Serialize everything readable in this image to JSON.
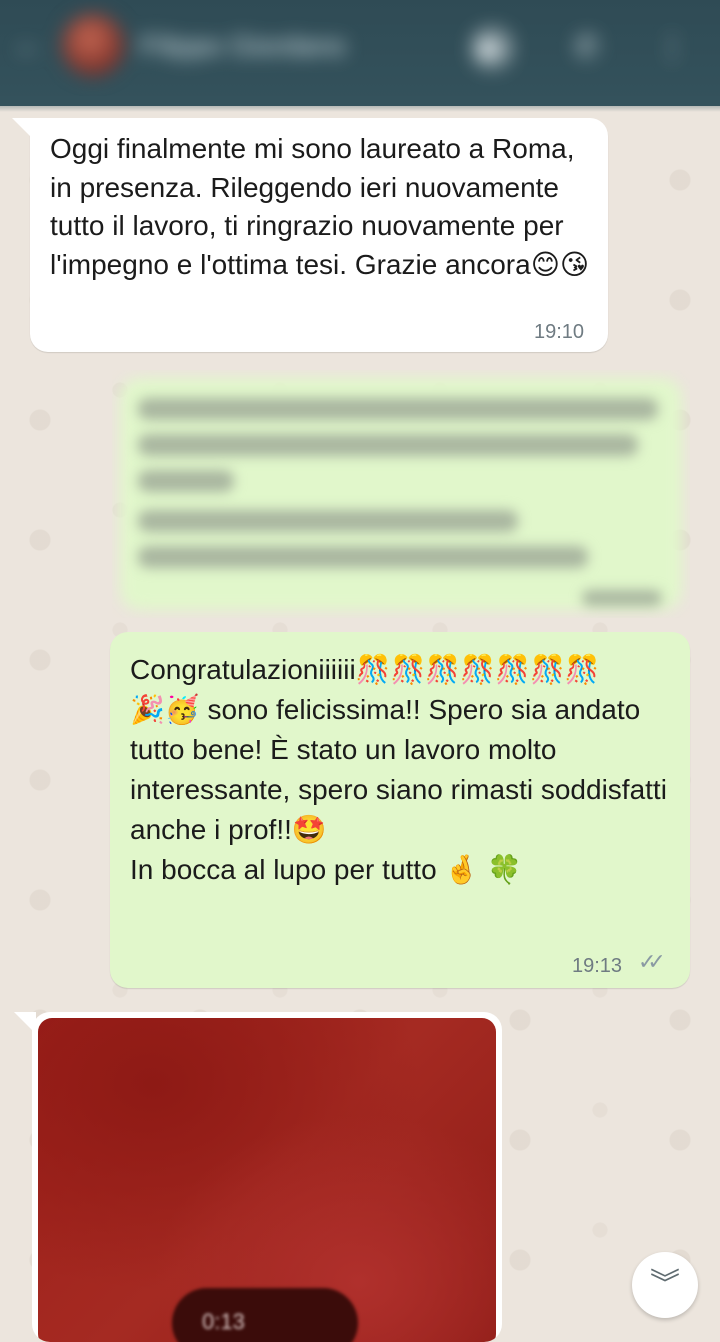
{
  "header": {
    "back_icon": "arrow-left-icon",
    "contact_name": "Filippo Giordano",
    "video_icon": "video-camera-icon",
    "call_icon": "phone-icon",
    "menu_icon": "vertical-dots-icon"
  },
  "messages": [
    {
      "direction": "incoming",
      "text": "Oggi finalmente mi sono laureato a Roma, in presenza. Rileggendo ieri nuovamente tutto il lavoro, ti ringrazio nuovamente per l'impegno e l'ottima tesi. Grazie ancora😊😘",
      "time": "19:10"
    },
    {
      "direction": "outgoing",
      "text": "",
      "time": ""
    },
    {
      "direction": "outgoing",
      "text": "Congratulazioniiiiii🎊🎊🎊🎊🎊🎊🎊\n🎉🥳 sono felicissima!! Spero sia andato tutto bene! È stato un lavoro molto interessante, spero siano rimasti soddisfatti anche i prof!!🤩\nIn bocca al lupo per tutto 🤞 🍀",
      "time": "19:13",
      "status_icon": "double-check-icon"
    },
    {
      "direction": "incoming",
      "type": "image",
      "image_pill_text": "0:13"
    }
  ],
  "scroll_down_icon": "double-chevron-down-icon",
  "colors": {
    "header": "#34525c",
    "incoming_bubble": "#ffffff",
    "outgoing_bubble": "#e1f7cb",
    "wallpaper": "#ece5dd",
    "timestamp": "#6f7b82",
    "read_check": "#8a9aa3"
  }
}
